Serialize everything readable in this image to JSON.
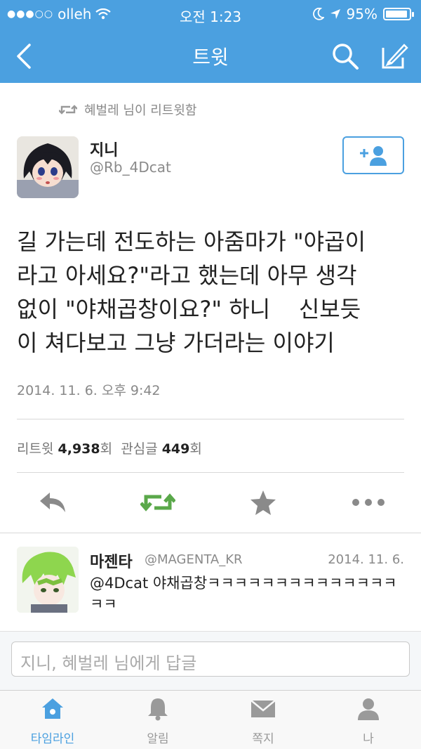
{
  "status": {
    "carrier": "olleh",
    "time": "오전 1:23",
    "battery": "95%",
    "battery_level": 0.95
  },
  "nav": {
    "title": "트윗",
    "back_icon": "back-chevron-icon",
    "search_icon": "search-icon",
    "compose_icon": "compose-icon"
  },
  "tweet": {
    "retweeted_by": "혜벌레 님이 리트윗함",
    "author_name": "지니",
    "author_handle": "@Rb_4Dcat",
    "text": "길 가는데 전도하는 아줌마가 \"야곱이\n라고 아세요?\"라고 했는데 아무 생각\n없이 \"야채곱창이요?\" 하니    신보듯\n이 쳐다보고 그냥 가더라는 이야기",
    "timestamp": "2014. 11. 6. 오후 9:42",
    "retweet_label": "리트윗",
    "retweet_count": "4,938",
    "retweet_unit": "회",
    "fav_label": "관심글",
    "fav_count": "449",
    "fav_unit": "회"
  },
  "reply": {
    "name": "마젠타",
    "handle": "@MAGENTA_KR",
    "date": "2014. 11. 6.",
    "text": "@4Dcat 야채곱창ㅋㅋㅋㅋㅋㅋㅋㅋㅋㅋㅋㅋㅋㅋㅋㅋ"
  },
  "compose": {
    "placeholder": "지니, 혜벌레 님에게 답글"
  },
  "tabs": [
    {
      "label": "타임라인",
      "icon": "home-icon"
    },
    {
      "label": "알림",
      "icon": "bell-icon"
    },
    {
      "label": "쪽지",
      "icon": "mail-icon"
    },
    {
      "label": "나",
      "icon": "person-icon"
    }
  ],
  "colors": {
    "accent": "#4ba0e0",
    "retweet_green": "#5aa84a"
  }
}
